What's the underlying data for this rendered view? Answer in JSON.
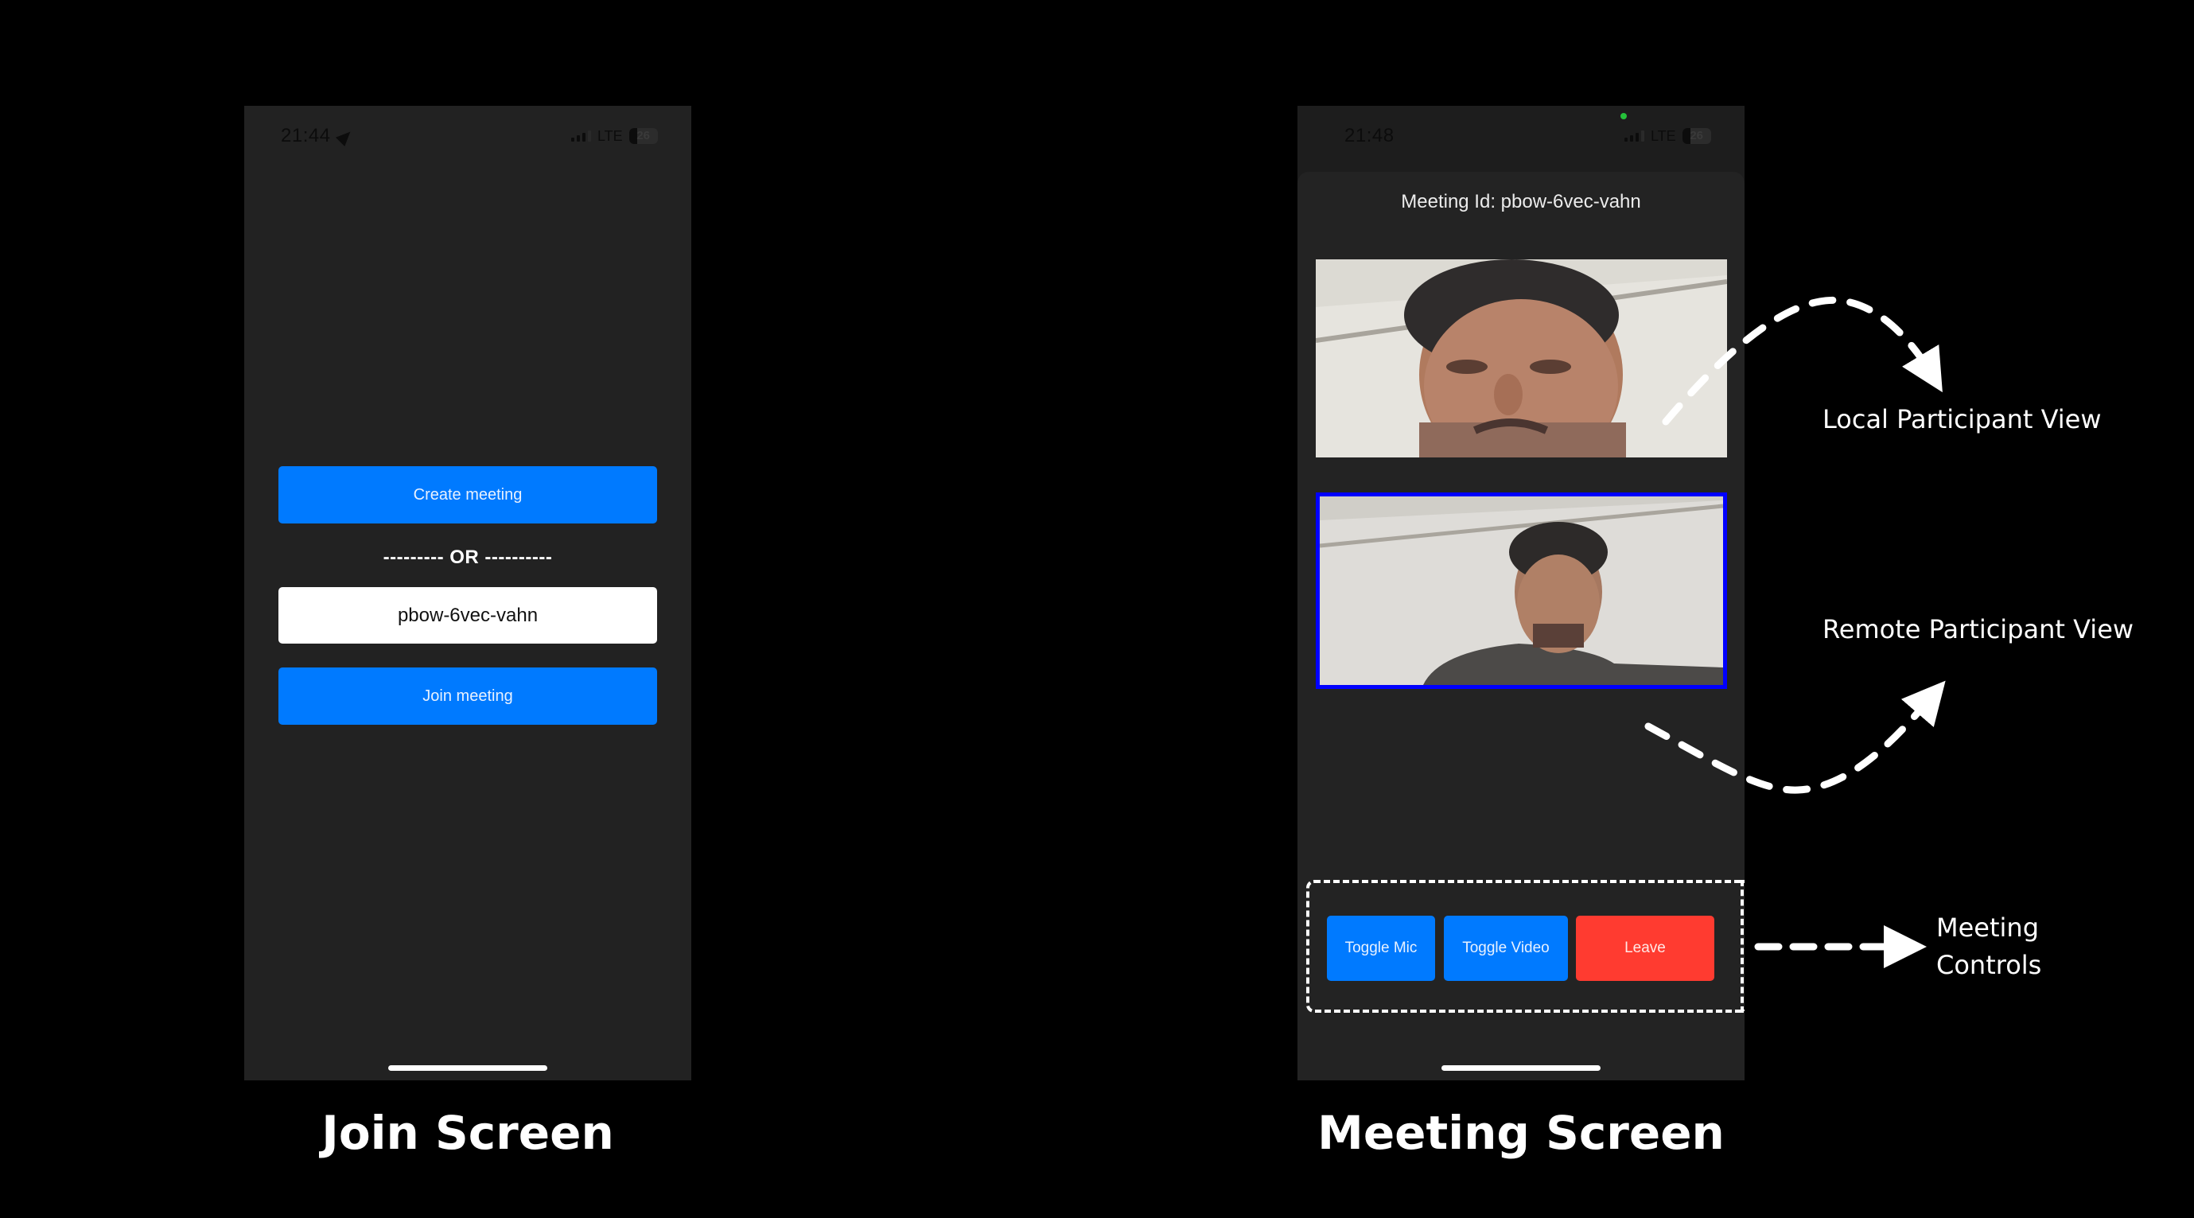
{
  "join_screen": {
    "status_bar": {
      "time": "21:44",
      "network": "LTE",
      "battery": "26",
      "location_icon": "location-arrow-icon"
    },
    "create_button": "Create meeting",
    "separator": "--------- OR ----------",
    "meeting_input": {
      "value": "pbow-6vec-vahn",
      "placeholder": ""
    },
    "join_button": "Join meeting",
    "caption": "Join Screen"
  },
  "meeting_screen": {
    "status_bar": {
      "time": "21:48",
      "network": "LTE",
      "battery": "26",
      "camera_in_use_indicator": "green-dot"
    },
    "meeting_id_label": "Meeting Id: pbow-6vec-vahn",
    "local_tile": {
      "role": "local-participant",
      "video": "camera feed"
    },
    "remote_tile": {
      "role": "remote-participant",
      "video": "camera feed",
      "highlight_color": "#0000ff"
    },
    "controls": {
      "toggle_mic": "Toggle Mic",
      "toggle_video": "Toggle Video",
      "leave": "Leave"
    },
    "caption": "Meeting Screen"
  },
  "annotations": {
    "local_participant": "Local Participant View",
    "remote_participant": "Remote Participant View",
    "meeting_controls_line1": "Meeting",
    "meeting_controls_line2": "Controls"
  },
  "colors": {
    "background": "#000000",
    "phone_bg": "#222222",
    "primary_button": "#007aff",
    "leave_button": "#ff3b30",
    "active_speaker_border": "#0000ff",
    "annotation": "#ffffff"
  }
}
